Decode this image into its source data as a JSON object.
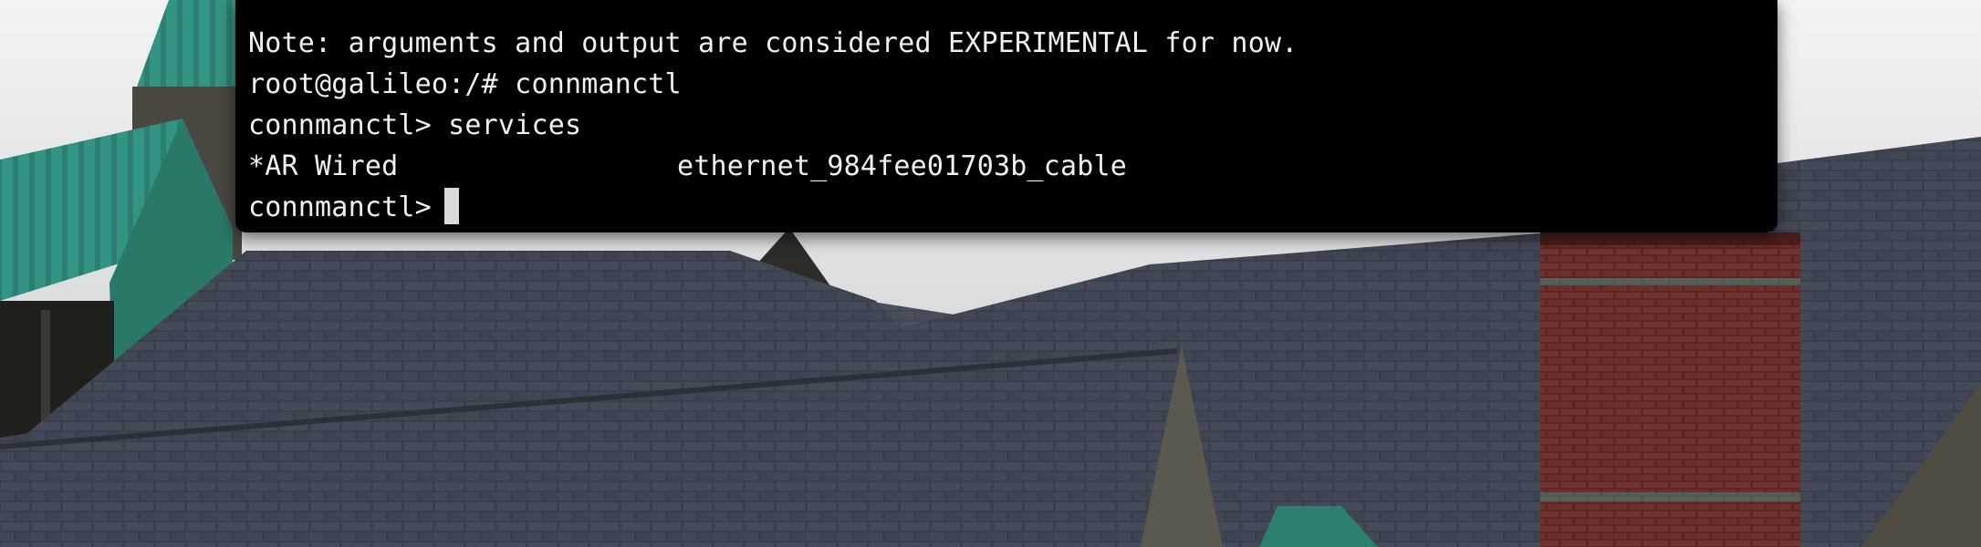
{
  "terminal": {
    "lines": [
      "Note: arguments and output are considered EXPERIMENTAL for now.",
      "root@galileo:/# connmanctl",
      "connmanctl> services"
    ],
    "service": {
      "flags_name": "*AR Wired",
      "identifier": "ethernet_984fee01703b_cable"
    },
    "prompt": "connmanctl>"
  },
  "wallpaper": {
    "subject": "slate-roof-building",
    "colors": {
      "sky": "#e9eaea",
      "slate_roof": "#3d4250",
      "copper_roof": "#2f8d7e",
      "brick_chimney": "#6a2f2b"
    }
  }
}
